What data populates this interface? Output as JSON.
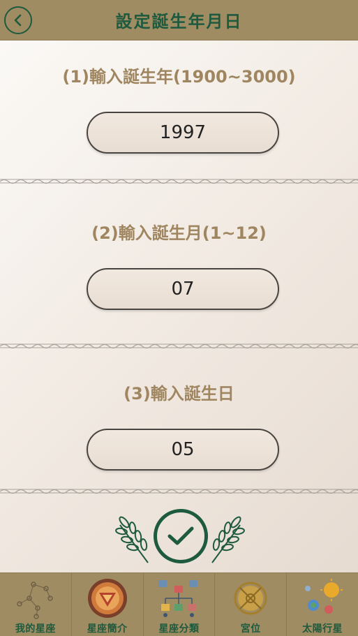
{
  "header": {
    "title": "設定誕生年月日",
    "back_icon": "chevron-left-icon"
  },
  "sections": [
    {
      "label": "(1)輸入誕生年(1900~3000)",
      "value": "1997"
    },
    {
      "label": "(2)輸入誕生月(1~12)",
      "value": "07"
    },
    {
      "label": "(3)輸入誕生日",
      "value": "05"
    }
  ],
  "confirm": {
    "icon": "checkmark-icon"
  },
  "nav": [
    {
      "label": "我的星座",
      "icon": "constellation-icon"
    },
    {
      "label": "星座簡介",
      "icon": "zodiac-wheel-icon"
    },
    {
      "label": "星座分類",
      "icon": "classification-tree-icon"
    },
    {
      "label": "宮位",
      "icon": "house-wheel-icon"
    },
    {
      "label": "太陽行星",
      "icon": "sun-planets-icon"
    }
  ],
  "colors": {
    "header_bg": "#a08c62",
    "accent_green": "#1d5a3e",
    "label_gold": "#a08660"
  }
}
